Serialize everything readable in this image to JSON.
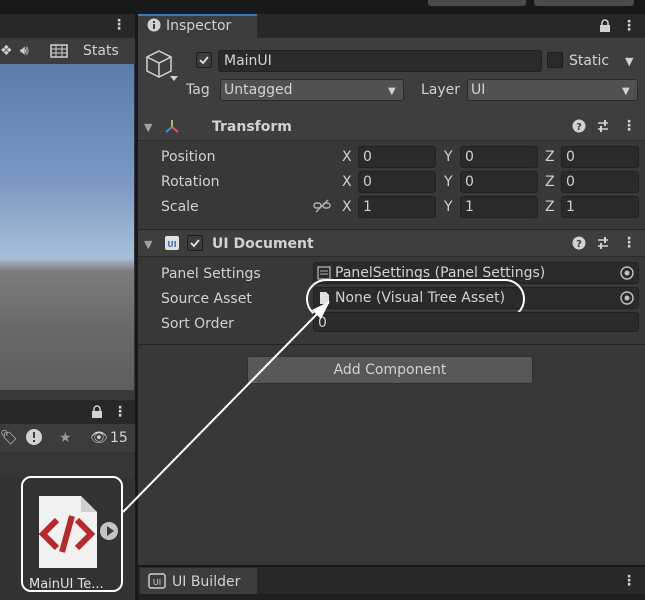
{
  "scene_toolbar": {
    "stats_label": "Stats"
  },
  "inspector": {
    "tab_label": "Inspector",
    "object_name": "MainUI",
    "static_label": "Static",
    "tag_label": "Tag",
    "tag_value": "Untagged",
    "layer_label": "Layer",
    "layer_value": "UI"
  },
  "transform": {
    "title": "Transform",
    "rows": [
      {
        "label": "Position",
        "x": "0",
        "y": "0",
        "z": "0"
      },
      {
        "label": "Rotation",
        "x": "0",
        "y": "0",
        "z": "0"
      },
      {
        "label": "Scale",
        "x": "1",
        "y": "1",
        "z": "1"
      }
    ],
    "axis": {
      "x": "X",
      "y": "Y",
      "z": "Z"
    }
  },
  "ui_document": {
    "title": "UI Document",
    "panel_settings_label": "Panel Settings",
    "panel_settings_value": "PanelSettings (Panel Settings)",
    "source_asset_label": "Source Asset",
    "source_asset_value": "None (Visual Tree Asset)",
    "sort_order_label": "Sort Order",
    "sort_order_value": "0"
  },
  "add_component_label": "Add Component",
  "project": {
    "hidden_count": "15",
    "asset_name": "MainUI Te..."
  },
  "ui_builder_tab": "UI Builder",
  "colors": {
    "accent_red": "#b8282c",
    "highlight_border": "#ffffff"
  }
}
